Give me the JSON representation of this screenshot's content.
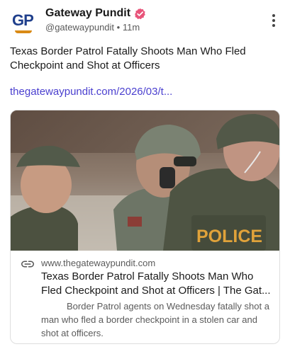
{
  "account": {
    "avatar_text": "GP",
    "name": "Gateway Pundit",
    "handle": "@gatewaypundit",
    "separator": "•",
    "time": "11m",
    "verified": true,
    "verified_color": "#e8547a",
    "brand_color": "#1f3f8c"
  },
  "post": {
    "text_lines": [
      "Texas Border Patrol Fatally Shoots Man Who Fled",
      "Checkpoint and Shot at Officers"
    ],
    "link": "thegatewaypundit.com/2026/03/t...",
    "link_color": "#4a3fcf"
  },
  "card": {
    "image_sign": "POLICE",
    "domain": "www.thegatewaypundit.com",
    "title_lines": [
      "Texas Border Patrol Fatally Shoots Man Who",
      "Fled Checkpoint and Shot at Officers | The Gat..."
    ],
    "description_lines": [
      "Border Patrol agents on Wednesday fatally shot a",
      "man who fled a border checkpoint in a stolen car and",
      "shot at officers."
    ]
  },
  "icons": {
    "verified": "verified-badge-icon",
    "more": "more-options-icon",
    "link": "link-icon"
  }
}
